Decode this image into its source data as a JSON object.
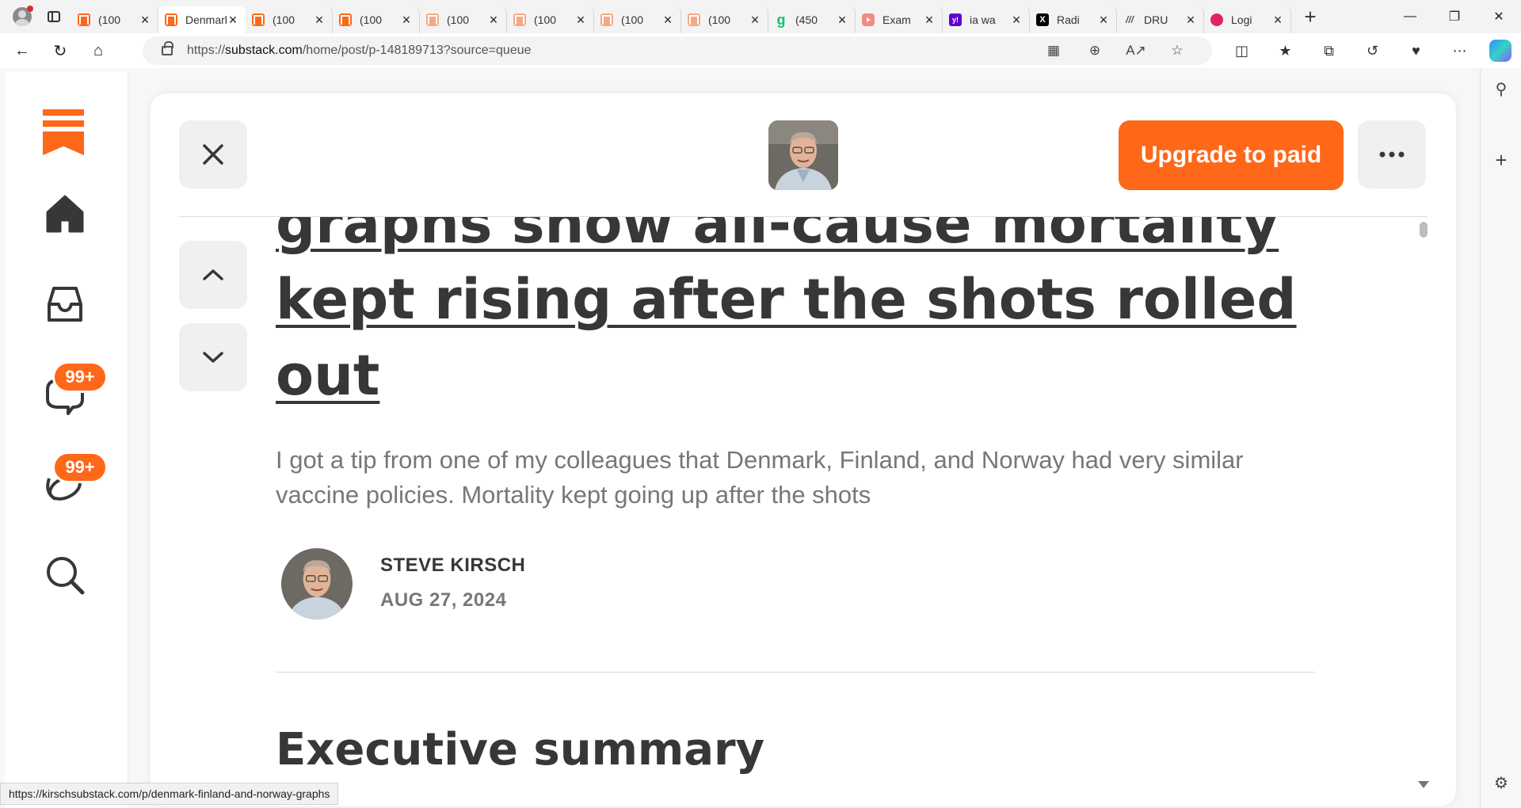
{
  "browser": {
    "tabs": [
      {
        "label": "(100",
        "favicon": "substack-icon",
        "active": false
      },
      {
        "label": "Denmark",
        "favicon": "substack-icon",
        "active": true
      },
      {
        "label": "(100",
        "favicon": "substack-icon",
        "active": false
      },
      {
        "label": "(100",
        "favicon": "substack-icon",
        "active": false
      },
      {
        "label": "(100",
        "favicon": "substack-faded-icon",
        "active": false
      },
      {
        "label": "(100",
        "favicon": "substack-faded-icon",
        "active": false
      },
      {
        "label": "(100",
        "favicon": "substack-faded-icon",
        "active": false
      },
      {
        "label": "(100",
        "favicon": "substack-faded-icon",
        "active": false
      },
      {
        "label": "(450",
        "favicon": "grammarly-icon",
        "active": false
      },
      {
        "label": "Exam",
        "favicon": "youtube-icon",
        "active": false
      },
      {
        "label": "ia wa",
        "favicon": "yahoo-icon",
        "active": false
      },
      {
        "label": "Radi",
        "favicon": "x-icon",
        "active": false
      },
      {
        "label": "DRU",
        "favicon": "drudge-icon",
        "active": false
      },
      {
        "label": "Logi",
        "favicon": "red-icon",
        "active": false
      }
    ],
    "favicon_glyphs": {
      "grammarly": "g",
      "yahoo": "y!",
      "x": "X",
      "drudge": "///"
    },
    "new_tab": "+",
    "url_prefix": "https://",
    "url_host": "substack.com",
    "url_path": "/home/post/p-148189713?source=queue",
    "status_url": "https://kirschsubstack.com/p/denmark-finland-and-norway-graphs"
  },
  "sidebar": {
    "badges": {
      "chat": "99+",
      "activity": "99+"
    }
  },
  "post": {
    "upgrade_label": "Upgrade to paid",
    "title": "graphs show all-cause mortality kept rising after the shots rolled out",
    "subtitle": "I got a tip from one of my colleagues that Denmark, Finland, and Norway had very similar vaccine policies. Mortality kept going up after the shots",
    "author": "STEVE KIRSCH",
    "date": "AUG 27, 2024",
    "section_heading": "Executive summary"
  },
  "colors": {
    "accent": "#ff6719",
    "text": "#363737",
    "muted": "#777777"
  }
}
